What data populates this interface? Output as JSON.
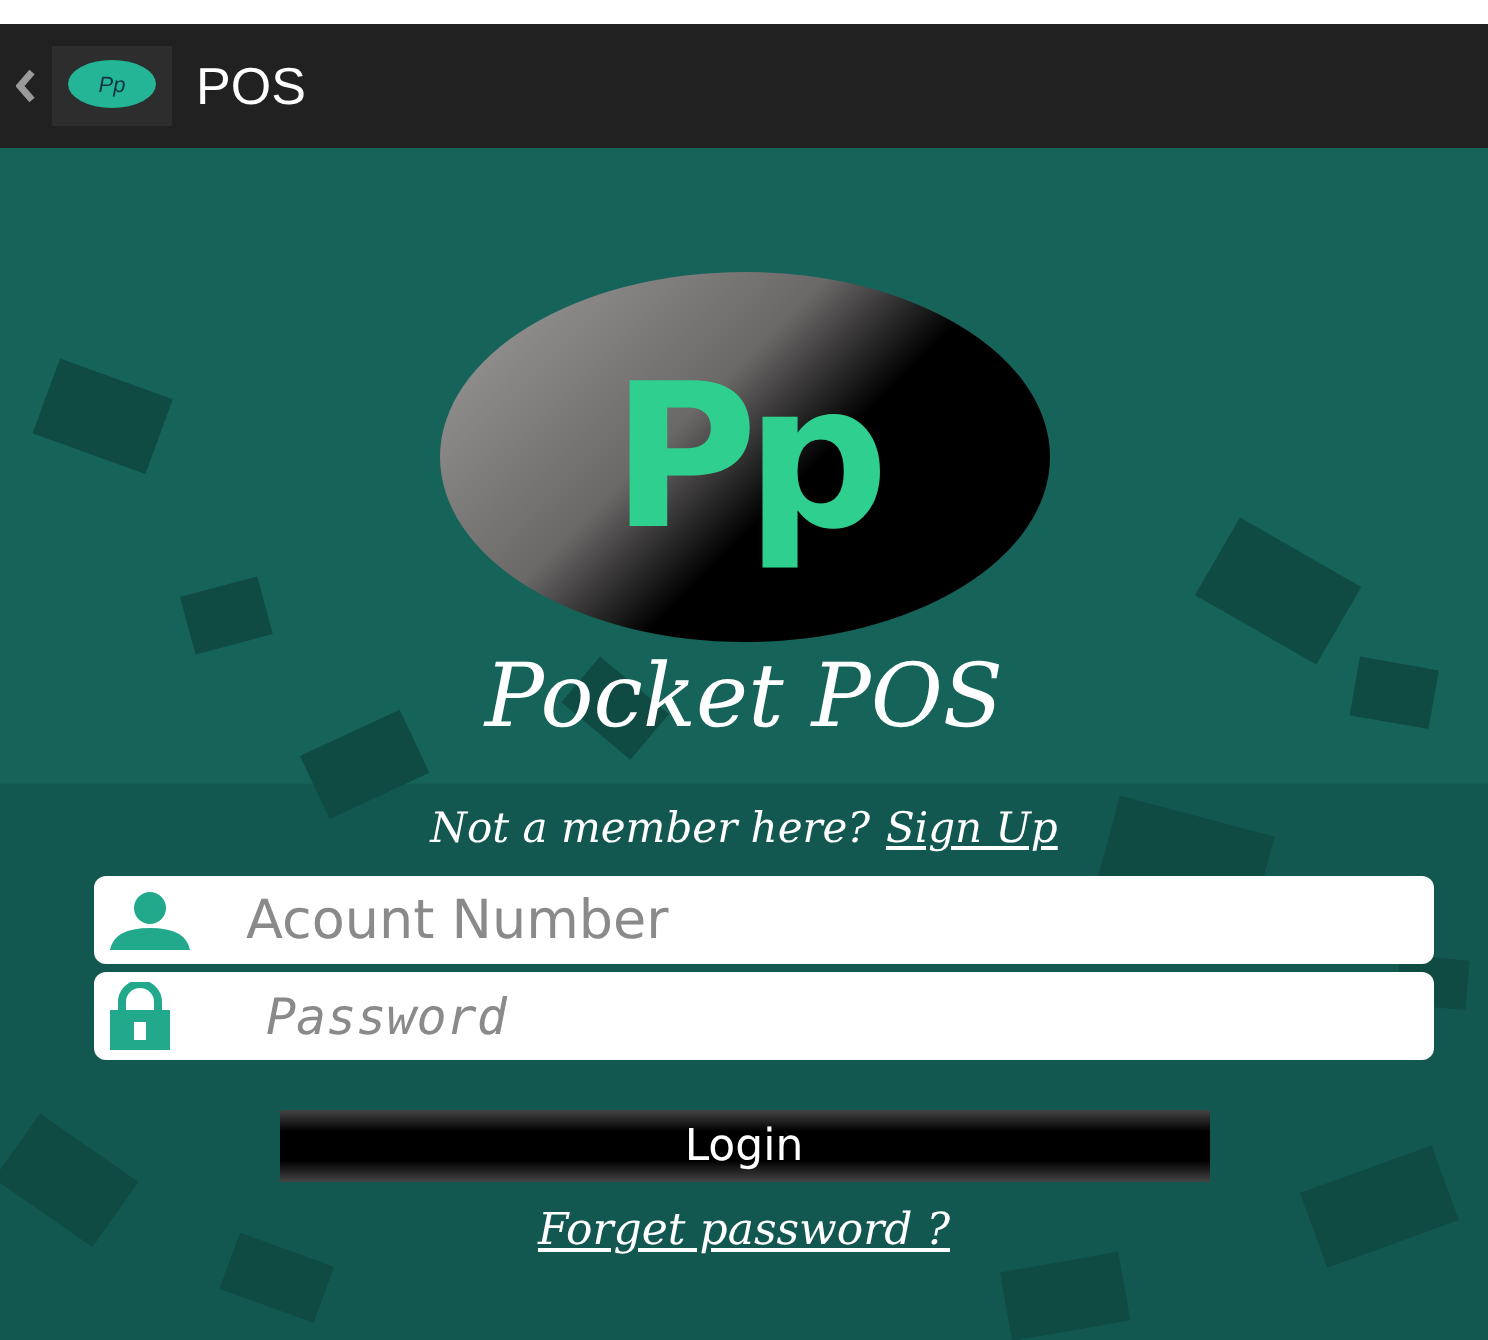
{
  "app_bar": {
    "icon_text": "Pp",
    "title": "POS"
  },
  "logo": {
    "letters": "Pp",
    "name": "Pocket POS"
  },
  "signup_prompt": {
    "text": "Not a member here?",
    "link": "Sign Up"
  },
  "fields": [
    {
      "kind": "user",
      "placeholder": "Acount Number"
    },
    {
      "kind": "lock",
      "placeholder": "Password"
    }
  ],
  "login_button": "Login",
  "forgot_link": "Forget password ?"
}
